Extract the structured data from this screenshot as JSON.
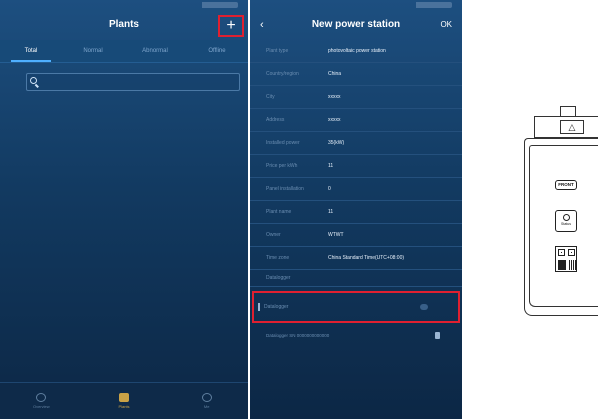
{
  "plants_screen": {
    "title": "Plants",
    "add_icon": "+",
    "tabs": [
      {
        "label": "Total",
        "active": true
      },
      {
        "label": "Normal",
        "active": false
      },
      {
        "label": "Abnormal",
        "active": false
      },
      {
        "label": "Offline",
        "active": false
      }
    ],
    "search_placeholder": "",
    "bottom_nav": [
      {
        "label": "Overview",
        "icon": "home-icon",
        "active": false
      },
      {
        "label": "Plants",
        "icon": "plant-icon",
        "active": true
      },
      {
        "label": "Me",
        "icon": "user-icon",
        "active": false
      }
    ]
  },
  "new_station_screen": {
    "title": "New power station",
    "back_icon": "‹",
    "ok_label": "OK",
    "fields": [
      {
        "label": "Plant type",
        "value": "photovoltaic power station"
      },
      {
        "label": "Country/region",
        "value": "China"
      },
      {
        "label": "City",
        "value": "xxxxx"
      },
      {
        "label": "Address",
        "value": "xxxxx"
      },
      {
        "label": "Installed power",
        "value": "35(kW)"
      },
      {
        "label": "Price per kWh",
        "value": "11"
      },
      {
        "label": "Panel installation",
        "value": "0"
      },
      {
        "label": "Plant name",
        "value": "11"
      },
      {
        "label": "Owner",
        "value": "WTWT"
      },
      {
        "label": "Time zone",
        "value": "China Standard Time(UTC+08:00)"
      }
    ],
    "section_label": "Datalogger",
    "highlight_label": "Datalogger",
    "footer_text": "Datalogger SN 0000000000000"
  },
  "device": {
    "front_label": "FRONT",
    "status_label": "Status",
    "cap_symbol": "△"
  },
  "colors": {
    "app_background": "#123a61",
    "highlight": "#e02030",
    "tab_indicator": "#4fb0ff",
    "nav_active": "#c9a246"
  }
}
